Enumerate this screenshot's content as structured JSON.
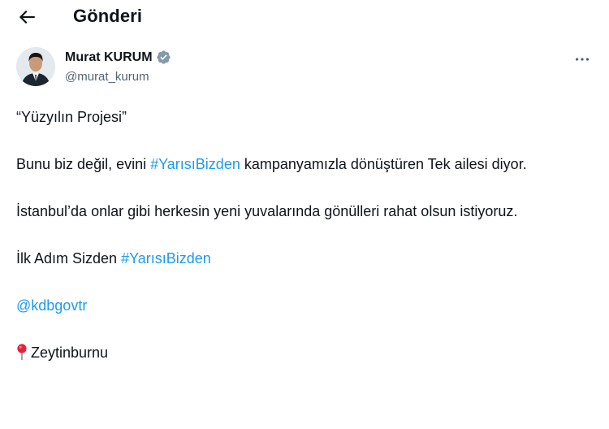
{
  "header": {
    "title": "Gönderi",
    "back_icon": "arrow-left-icon"
  },
  "author": {
    "name": "Murat KURUM",
    "handle": "@murat_kurum",
    "verified_icon": "verified-badge-icon",
    "more_icon": "more-horizontal-icon"
  },
  "tweet": {
    "p1": "“Yüzyılın Projesi”",
    "p2_before": "Bunu biz değil, evini ",
    "p2_hashtag": "#YarısıBizden",
    "p2_after": " kampanyamızla dönüştüren Tek ailesi diyor.",
    "p3": "İstanbul’da onlar gibi herkesin yeni yuvalarında gönülleri rahat olsun istiyoruz.",
    "p4_before": "İlk Adım Sizden ",
    "p4_hashtag": "#YarısıBizden",
    "mention": "@kdbgovtr",
    "location_icon": "round-pushpin-icon",
    "location": "Zeytinburnu"
  },
  "colors": {
    "link": "#1d9bf0",
    "text": "#0f1419",
    "secondary": "#536471",
    "verified": "#829aab"
  }
}
